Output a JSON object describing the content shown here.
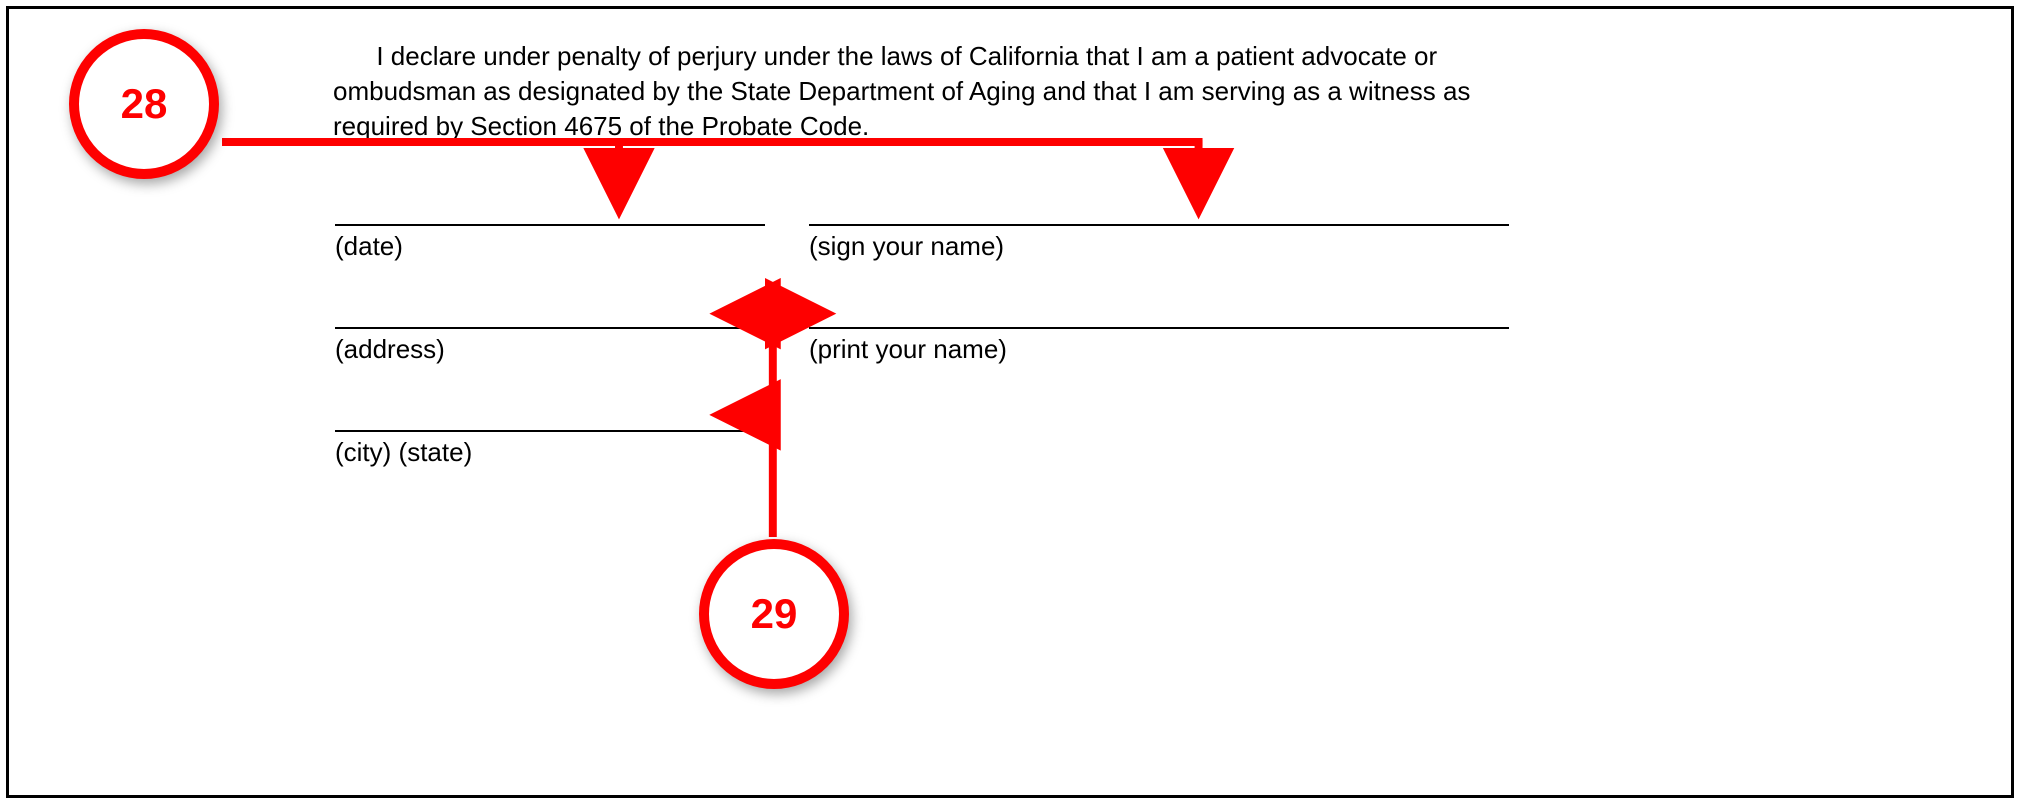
{
  "declaration_text": "      I declare under penalty of perjury under the laws of California that I am a patient advocate or ombudsman as designated by the State Department of Aging and that I am serving as a witness as required by Section 4675 of the Probate Code.",
  "fields": {
    "date_label": "(date)",
    "address_label": "(address)",
    "city_state_label": "(city) (state)",
    "sign_label": "(sign your name)",
    "print_label": "(print your name)"
  },
  "callouts": {
    "c28": "28",
    "c29": "29"
  },
  "accent_color": "#fe0000"
}
